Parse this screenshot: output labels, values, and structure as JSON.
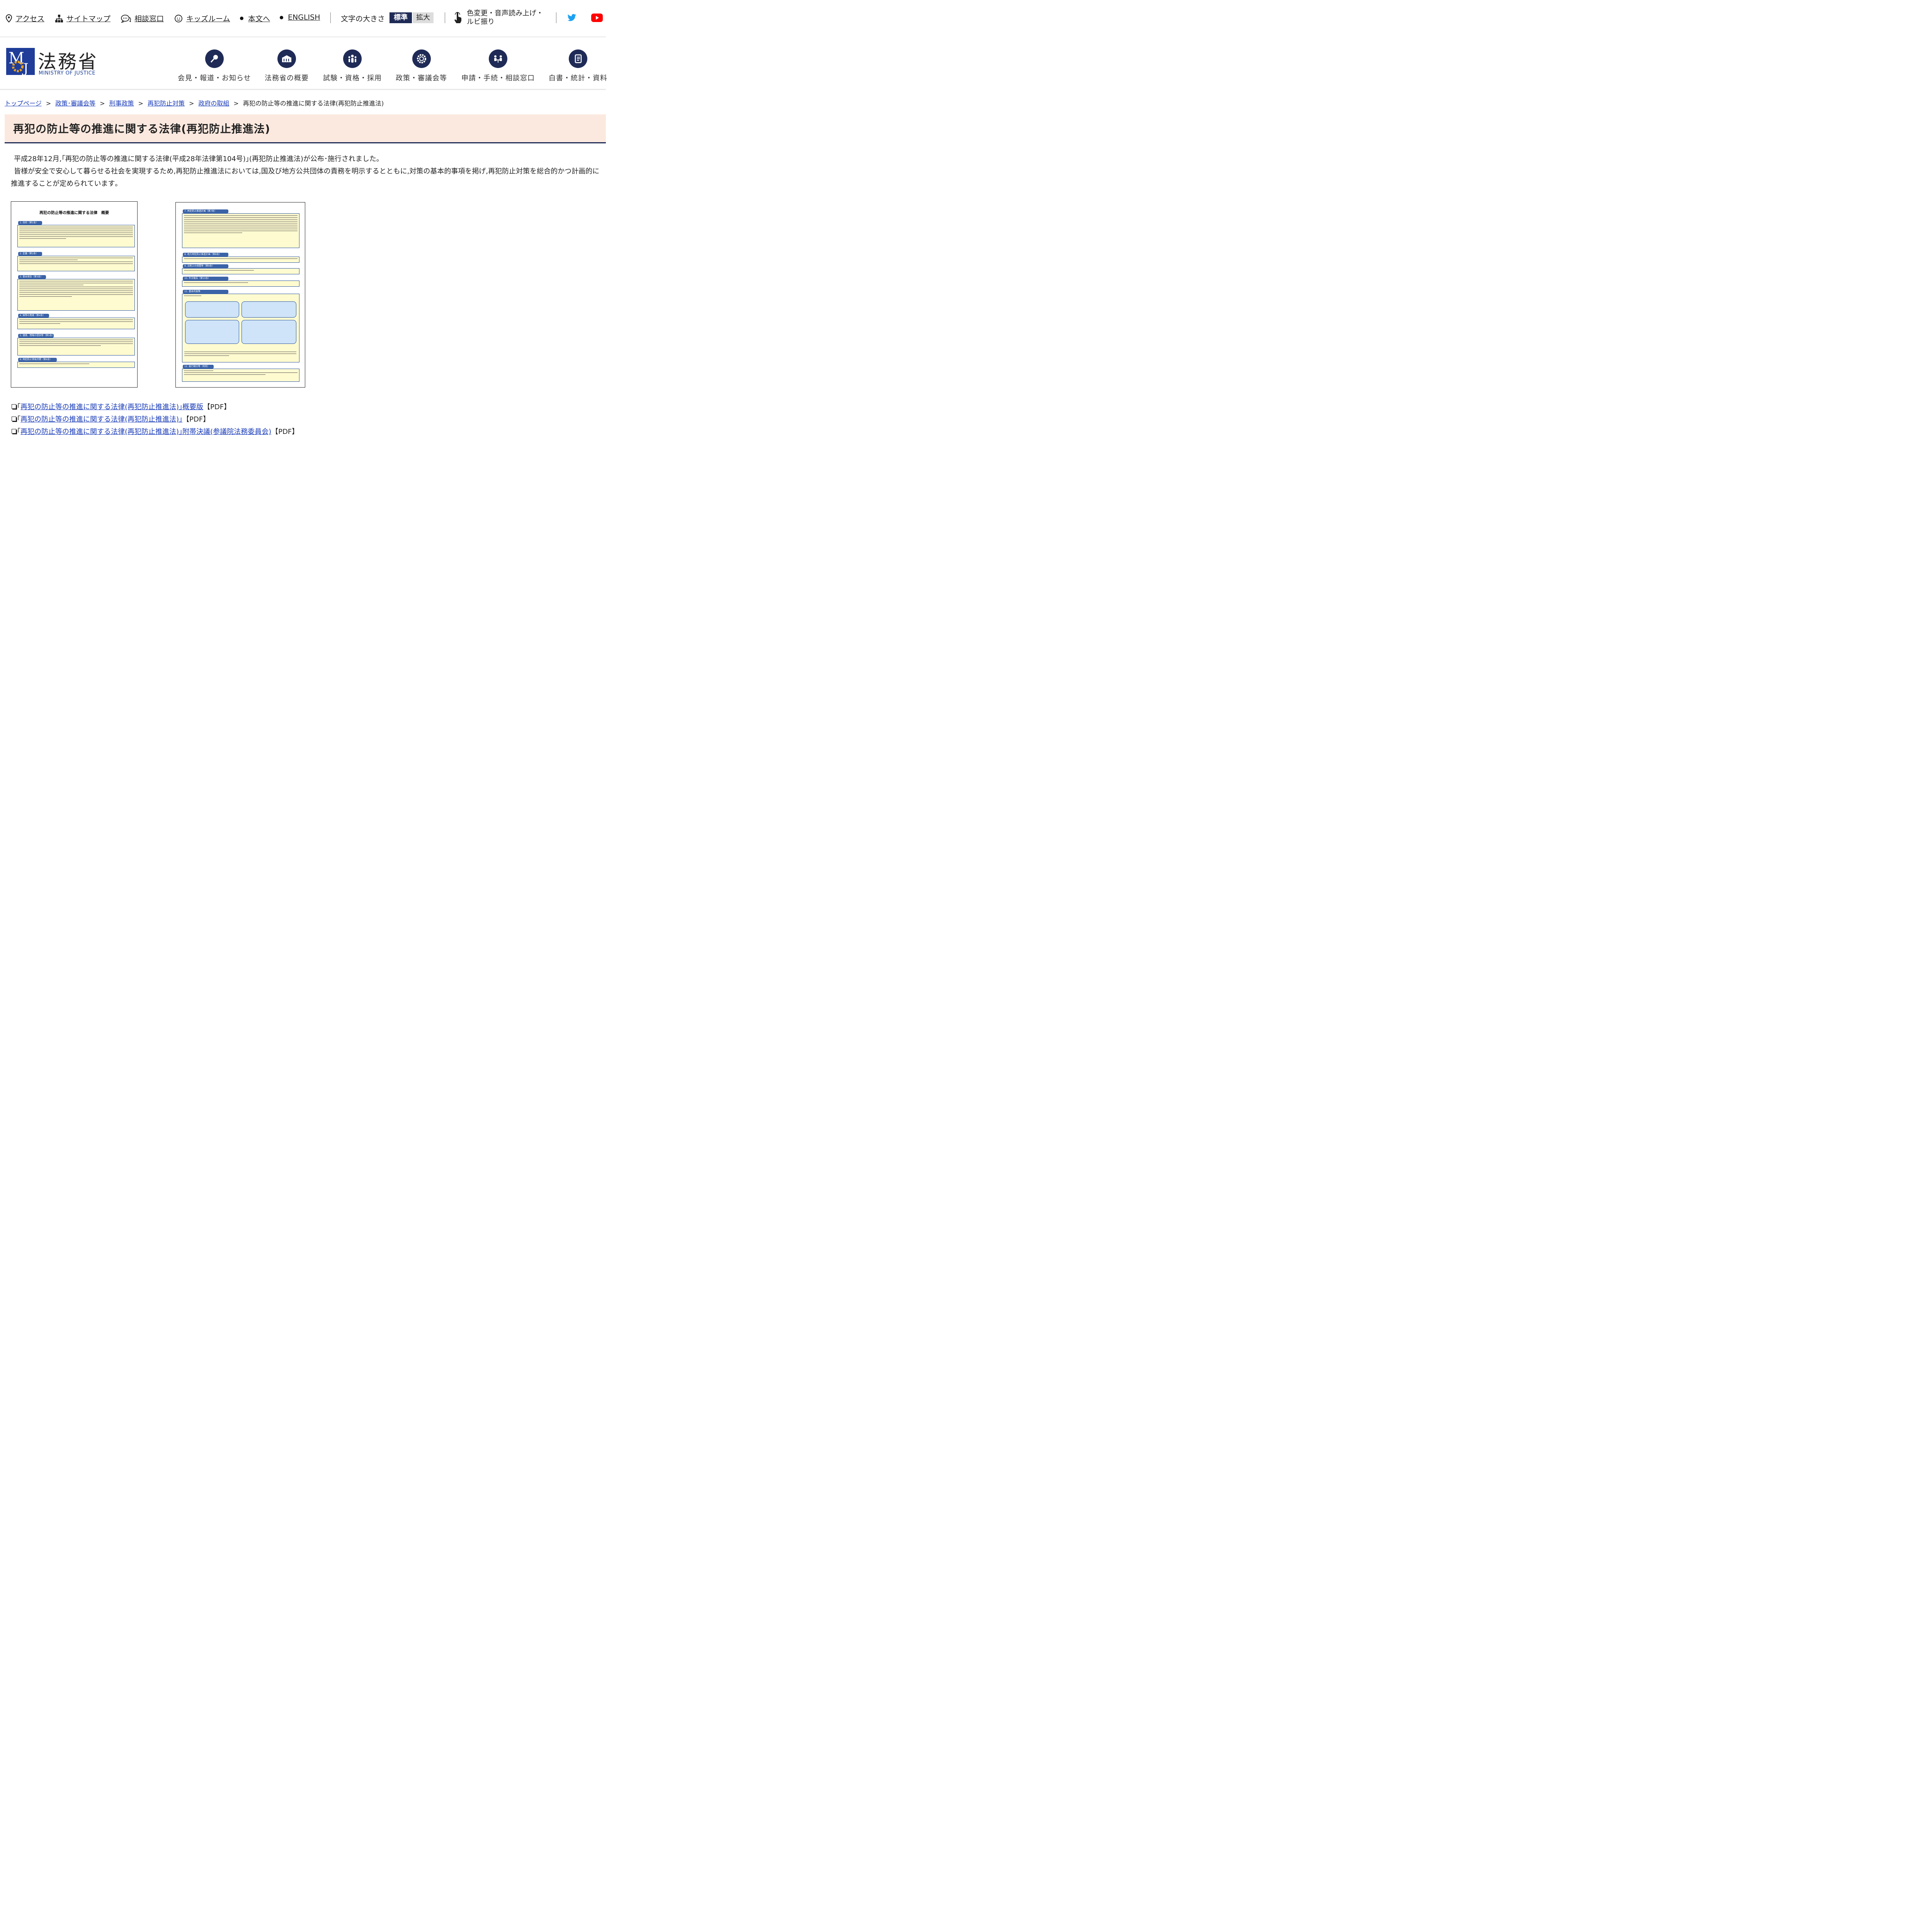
{
  "utility": {
    "access": "アクセス",
    "sitemap": "サイトマップ",
    "consult": "相談窓口",
    "kids": "キッズルーム",
    "to_body": "本文へ",
    "english": "ENGLISH",
    "font_size_label": "文字の大きさ",
    "font_standard": "標準",
    "font_large": "拡大",
    "accessibility_line1": "色変更・音声読み上げ・",
    "accessibility_line2": "ルビ振り"
  },
  "header": {
    "logo_title": "法務省",
    "logo_subtitle": "MINISTRY OF JUSTICE",
    "nav": [
      {
        "label": "会見・報道・お知らせ",
        "icon": "microphone-icon"
      },
      {
        "label": "法務省の概要",
        "icon": "building-icon"
      },
      {
        "label": "試験・資格・採用",
        "icon": "people-icon"
      },
      {
        "label": "政策・審議会等",
        "icon": "gear-icon"
      },
      {
        "label": "申請・手続・相談窓口",
        "icon": "consultation-icon"
      },
      {
        "label": "白書・統計・資料",
        "icon": "document-icon"
      }
    ]
  },
  "breadcrumb": {
    "items": [
      "トップページ",
      "政策･審議会等",
      "刑事政策",
      "再犯防止対策",
      "政府の取組"
    ],
    "separator": ">",
    "current": "再犯の防止等の推進に関する法律(再犯防止推進法)"
  },
  "page": {
    "title": "再犯の防止等の推進に関する法律(再犯防止推進法)",
    "paragraph1": "平成28年12月,｢再犯の防止等の推進に関する法律(平成28年法律第104号)｣(再犯防止推進法)が公布･施行されました｡",
    "paragraph2": "皆様が安全で安心して暮らせる社会を実現するため,再犯防止推進法においては,国及び地方公共団体の責務を明示するとともに,対策の基本的事項を掲げ,再犯防止対策を総合的かつ計画的に推進することが定められています｡"
  },
  "doc_image": {
    "heading": "再犯の防止等の推進に関する法律　概要",
    "sections_left": [
      "1. 目的（第1条）",
      "2. 定義（第2条）",
      "3. 基本理念（第3条）",
      "4. 国等の責務（第4条）",
      "5. 連携、情報の提供等（第5条）",
      "6. 再犯防止啓発月間（第6条）"
    ],
    "sections_right": [
      "7. 再犯防止推進計画（第7条）",
      "8. 地方再犯防止推進計画（第8条）",
      "9. 法制上の措置等（第9条）",
      "10. 年次報告（第10条）",
      "11. 基本的施策",
      "12. 施行期日等（附則）"
    ]
  },
  "pdf_links": [
    {
      "prefix": "｢",
      "text": "再犯の防止等の推進に関する法律(再犯防止推進法)｣概要版",
      "tag": "【PDF】"
    },
    {
      "prefix": "｢",
      "text": "再犯の防止等の推進に関する法律(再犯防止推進法)｣",
      "tag": "【PDF】"
    },
    {
      "prefix": "｢",
      "text": "再犯の防止等の推進に関する法律(再犯防止推進法)｣附帯決議(参議院法務委員会)",
      "tag": "【PDF】"
    }
  ],
  "colors": {
    "navy": "#1f2b56",
    "link": "#1a3cb8",
    "title_bg": "#fbe9df"
  }
}
